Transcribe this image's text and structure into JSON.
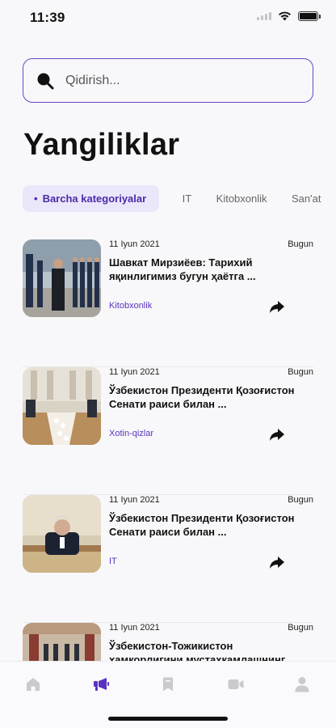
{
  "status": {
    "time": "11:39"
  },
  "search": {
    "placeholder": "Qidirish..."
  },
  "page": {
    "title": "Yangiliklar"
  },
  "tabs": [
    {
      "label": "Barcha kategoriyalar",
      "active": true
    },
    {
      "label": "IT",
      "active": false
    },
    {
      "label": "Kitobxonlik",
      "active": false
    },
    {
      "label": "San'at",
      "active": false
    }
  ],
  "news": [
    {
      "date": "11 Iyun 2021",
      "badge": "Bugun",
      "title": "Шавкат Мирзиёев: Тарихий яқинлигимиз бугун ҳаётга ...",
      "category": "Kitobxonlik"
    },
    {
      "date": "11 Iyun 2021",
      "badge": "Bugun",
      "title": "Ўзбекистон Президенти Қозоғистон Сенати раиси билан ...",
      "category": "Xotin-qizlar"
    },
    {
      "date": "11 Iyun 2021",
      "badge": "Bugun",
      "title": "Ўзбекистон Президенти Қозоғистон Сенати раиси билан ...",
      "category": "IT"
    },
    {
      "date": "11 Iyun 2021",
      "badge": "Bugun",
      "title": "Ўзбекистон-Тожикистон ҳамкорлигини мустаҳкамлашнинг...",
      "category": ""
    }
  ],
  "nav": [
    {
      "icon": "home-icon",
      "active": false
    },
    {
      "icon": "megaphone-icon",
      "active": true
    },
    {
      "icon": "bookmark-icon",
      "active": false
    },
    {
      "icon": "video-icon",
      "active": false
    },
    {
      "icon": "profile-icon",
      "active": false
    }
  ],
  "colors": {
    "accent": "#5a32c0",
    "active_tab_bg": "#ebe7fa",
    "inactive_icon": "#c9c9ce"
  }
}
